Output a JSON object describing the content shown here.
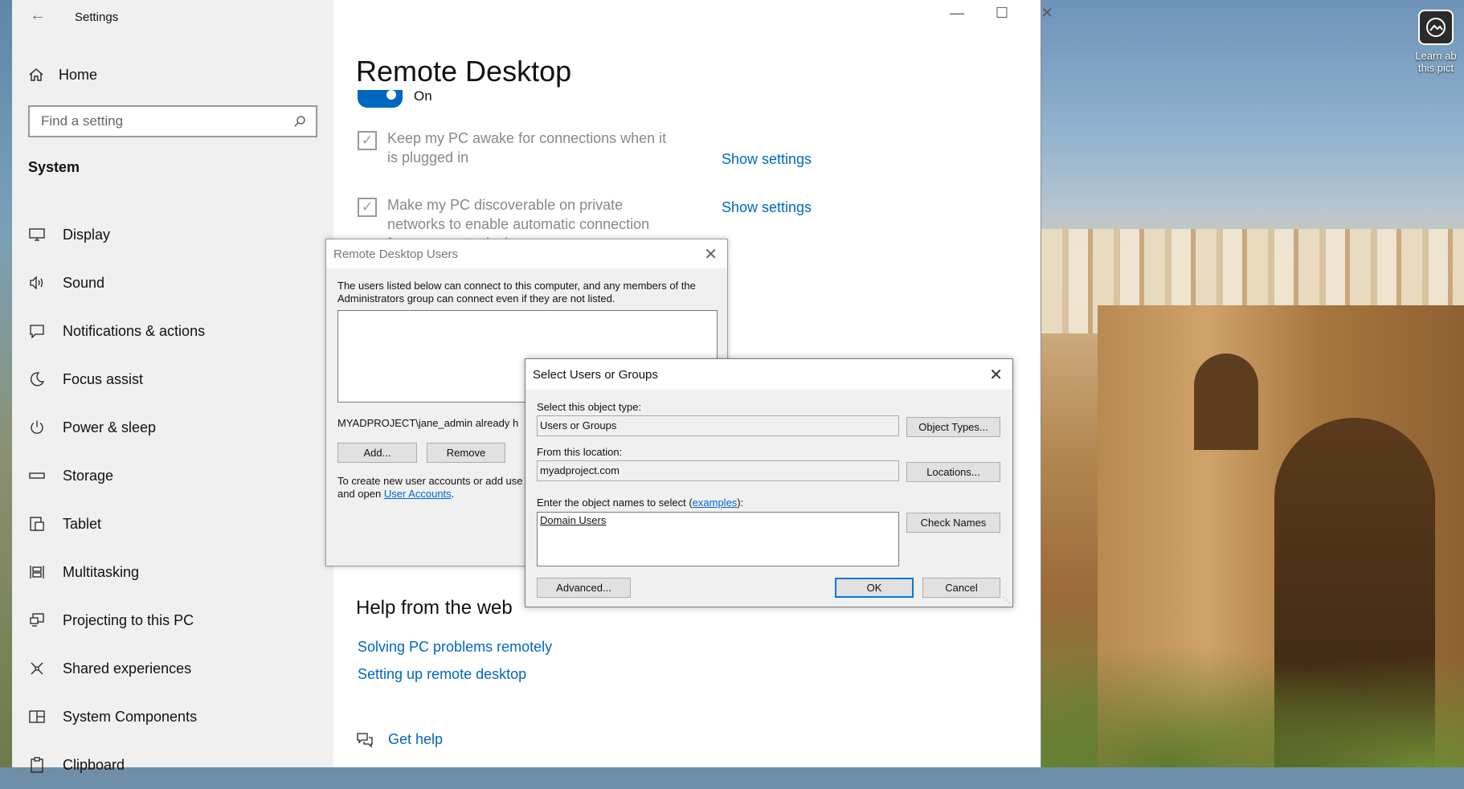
{
  "desktop": {
    "tile_text_line1": "Learn ab",
    "tile_text_line2": "this pict"
  },
  "settings": {
    "title": "Settings",
    "home_label": "Home",
    "search_placeholder": "Find a setting",
    "section": "System",
    "nav_items": [
      {
        "label": "Display",
        "icon": "display-icon"
      },
      {
        "label": "Sound",
        "icon": "sound-icon"
      },
      {
        "label": "Notifications & actions",
        "icon": "notifications-icon"
      },
      {
        "label": "Focus assist",
        "icon": "focus-assist-icon"
      },
      {
        "label": "Power & sleep",
        "icon": "power-icon"
      },
      {
        "label": "Storage",
        "icon": "storage-icon"
      },
      {
        "label": "Tablet",
        "icon": "tablet-icon"
      },
      {
        "label": "Multitasking",
        "icon": "multitasking-icon"
      },
      {
        "label": "Projecting to this PC",
        "icon": "projecting-icon"
      },
      {
        "label": "Shared experiences",
        "icon": "shared-experiences-icon"
      },
      {
        "label": "System Components",
        "icon": "system-components-icon"
      },
      {
        "label": "Clipboard",
        "icon": "clipboard-icon"
      }
    ],
    "page_title": "Remote Desktop",
    "toggle_state": "On",
    "checkbox1": "Keep my PC awake for connections when it is plugged in",
    "checkbox2": "Make my PC discoverable on private networks to enable automatic connection from a remote device",
    "show_settings": "Show settings",
    "help_title": "Help from the web",
    "help_links": [
      "Solving PC problems remotely",
      "Setting up remote desktop"
    ],
    "get_help": "Get help"
  },
  "rdu_dialog": {
    "title": "Remote Desktop Users",
    "description": "The users listed below can connect to this computer, and any members of the Administrators group can connect even if they are not listed.",
    "already_text": "MYADPROJECT\\jane_admin already h",
    "add_label": "Add...",
    "remove_label": "Remove",
    "note_line1": "To create new user accounts or add use",
    "note_line2_prefix": "and open ",
    "note_link": "User Accounts",
    "note_suffix": "."
  },
  "sug_dialog": {
    "title": "Select Users or Groups",
    "object_type_label": "Select this object type:",
    "object_type_value": "Users or Groups",
    "object_types_button": "Object Types...",
    "location_label": "From this location:",
    "location_value": "myadproject.com",
    "locations_button": "Locations...",
    "names_label_prefix": "Enter the object names to select (",
    "names_label_link": "examples",
    "names_label_suffix": "):",
    "names_value": "Domain Users",
    "check_names_button": "Check Names",
    "advanced_button": "Advanced...",
    "ok_button": "OK",
    "cancel_button": "Cancel"
  }
}
